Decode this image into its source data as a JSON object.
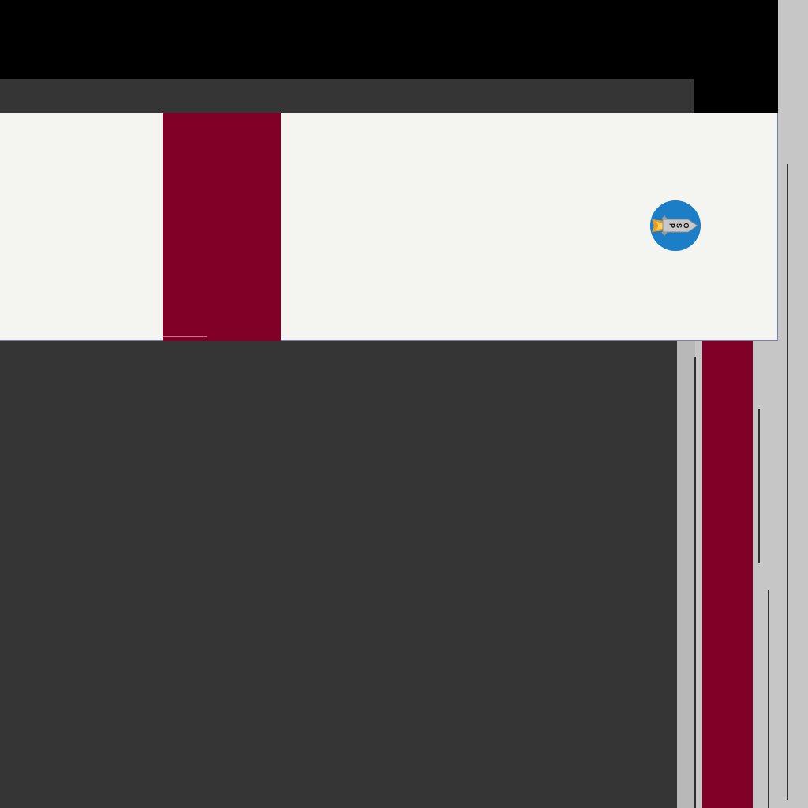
{
  "window": {
    "title": ""
  },
  "colors": {
    "black": "#000000",
    "dark_gray": "#353535",
    "light_gray": "#c6c6c6",
    "off_white": "#f4f5f1",
    "maroon": "#800027",
    "blue": "#1d7ec8",
    "orange": "#f29a1d",
    "accent_border": "#7c78c8"
  },
  "logo": {
    "icon": "osp-rocket-logo",
    "letters": [
      "O",
      "S",
      "P"
    ]
  },
  "panels": {
    "toolbar": "dark-toolbar",
    "main": "dark-main",
    "side": "right-gray"
  }
}
